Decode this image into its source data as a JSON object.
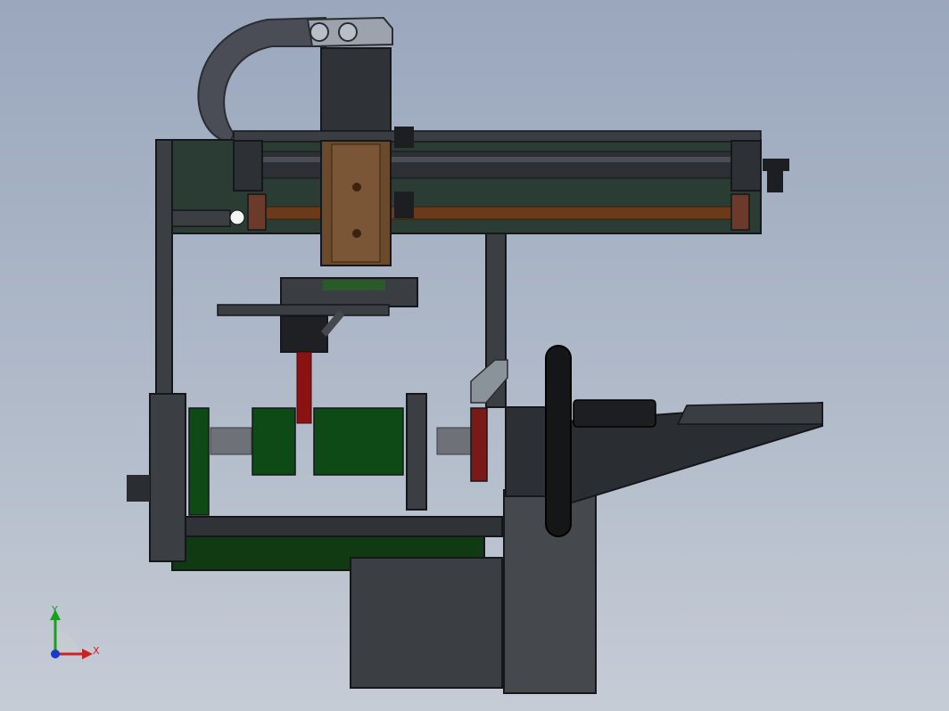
{
  "view": {
    "type": "CAD isometric/front view of mechanical assembly",
    "colors": {
      "background_top": "#9aa7bd",
      "background_bottom": "#c6ccd6",
      "frame": "#3b3f44",
      "plate_dark_green": "#1f3a2c",
      "green_part": "#0f4a1a",
      "brown_part": "#6b4a2c",
      "red_part": "#8a1212",
      "dark_gray": "#2a2d31"
    }
  },
  "triad": {
    "x_label": "X",
    "y_label": "Y",
    "x_color": "#cc2222",
    "y_color": "#1aa11a",
    "z_color": "#1a3acc"
  }
}
